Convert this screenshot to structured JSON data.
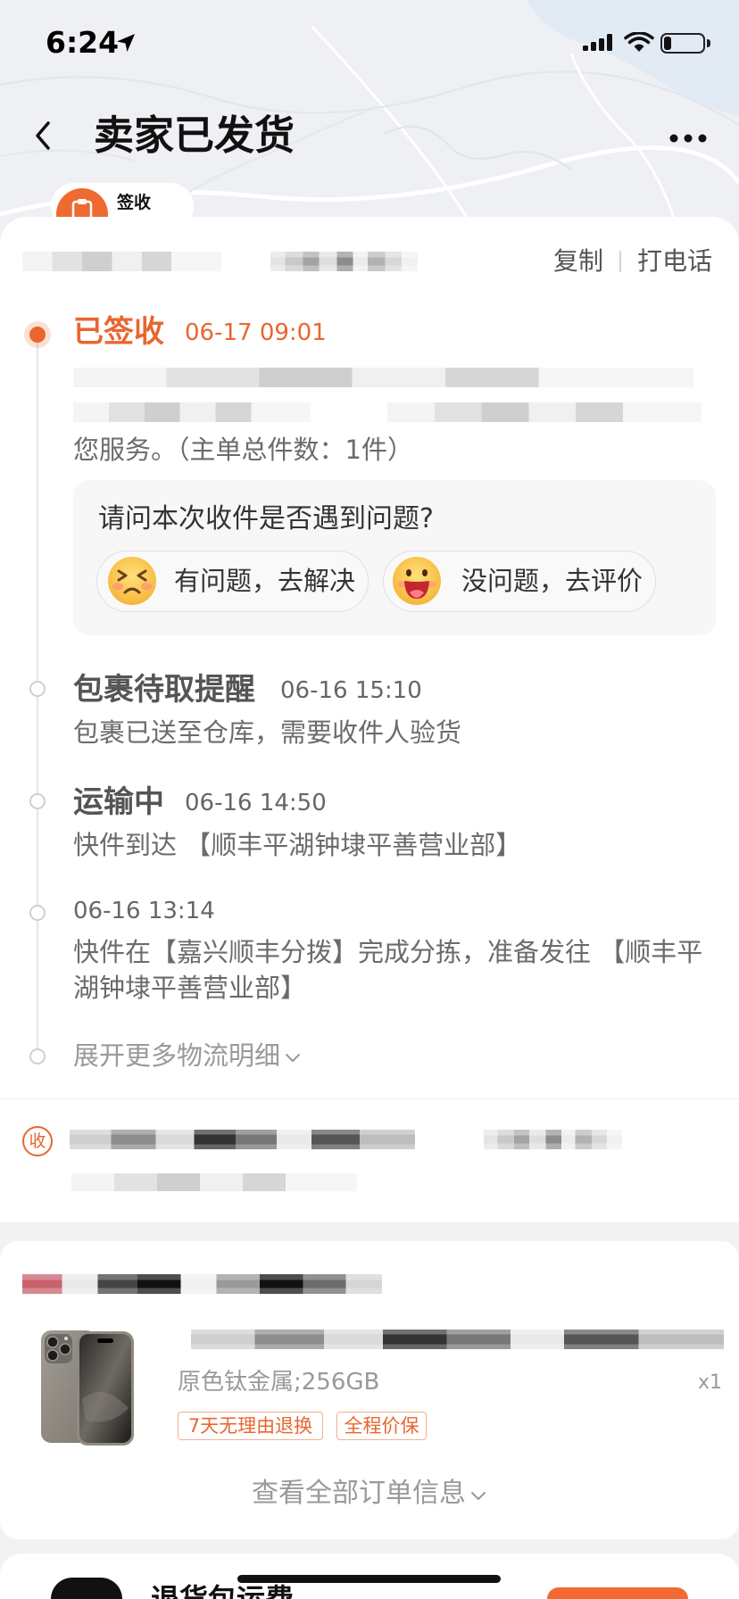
{
  "status_bar": {
    "time": "6:24",
    "battery_level": 0.2
  },
  "nav": {
    "title": "卖家已发货"
  },
  "badge": {
    "label": "签收"
  },
  "contact": {
    "copy_label": "复制",
    "call_label": "打电话"
  },
  "timeline": [
    {
      "status": "已签收",
      "time": "06-17 09:01",
      "desc": "您服务。（主单总件数：1件）"
    },
    {
      "status": "包裹待取提醒",
      "time": "06-16 15:10",
      "desc": "包裹已送至仓库，需要收件人验货"
    },
    {
      "status": "运输中",
      "time": "06-16 14:50",
      "desc": "快件到达 【顺丰平湖钟埭平善营业部】"
    },
    {
      "time": "06-16 13:14",
      "desc": "快件在【嘉兴顺丰分拨】完成分拣，准备发往 【顺丰平湖钟埭平善营业部】"
    }
  ],
  "expand_label": "展开更多物流明细",
  "feedback": {
    "question": "请问本次收件是否遇到问题?",
    "problem_label": "有问题，去解决",
    "ok_label": "没问题，去评价"
  },
  "address": {
    "icon_label": "收"
  },
  "order": {
    "sku": "原色钛金属;256GB",
    "quantity": "x1",
    "tags": [
      "7天无理由退换",
      "全程价保"
    ],
    "view_all_label": "查看全部订单信息"
  },
  "next_card": {
    "title": "退货包运费"
  },
  "colors": {
    "accent": "#e8662f",
    "page_background": "#f2f2f2",
    "text_secondary": "#999999"
  },
  "icons": {
    "back": "chevron-left-icon",
    "more": "more-dots-icon",
    "location": "location-arrow-icon",
    "signal": "cellular-signal-icon",
    "wifi": "wifi-icon",
    "battery": "battery-icon",
    "badge": "clipboard-icon",
    "problem_emoji": "distressed-face-icon",
    "ok_emoji": "laughing-face-icon",
    "expand": "chevron-down-icon",
    "product": "iphone-product-image"
  }
}
